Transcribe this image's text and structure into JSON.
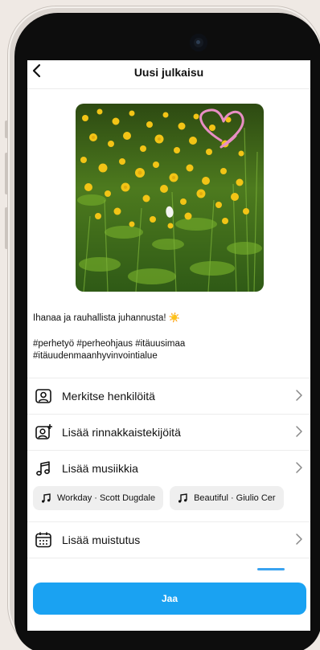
{
  "header": {
    "title": "Uusi julkaisu",
    "back_icon": "chevron-left-icon"
  },
  "post": {
    "image_alt": "yellow buttercup meadow photo with pink heart doodle",
    "caption_text": "Ihanaa ja rauhallista juhannusta! ☀️",
    "hashtags_line1": "#perhetyö #perheohjaus #itäuusimaa",
    "hashtags_line2": "#itäuudenmaanhyvinvointialue"
  },
  "menu": {
    "tag_people": {
      "label": "Merkitse henkilöitä",
      "icon": "tag-person-icon"
    },
    "add_collaborators": {
      "label": "Lisää rinnakkaistekijöitä",
      "icon": "add-collaborator-icon"
    },
    "add_music": {
      "label": "Lisää musiikkia",
      "icon": "music-note-icon"
    },
    "add_reminder": {
      "label": "Lisää muistutus",
      "icon": "calendar-icon"
    }
  },
  "music_suggestions": [
    {
      "label": "Workday · Scott Dugdale"
    },
    {
      "label": "Beautiful · Giulio Cer"
    }
  ],
  "actions": {
    "share_label": "Jaa"
  },
  "colors": {
    "accent": "#1aa2f2",
    "background": "#ffffff",
    "text": "#111111",
    "divider": "#ececec"
  }
}
